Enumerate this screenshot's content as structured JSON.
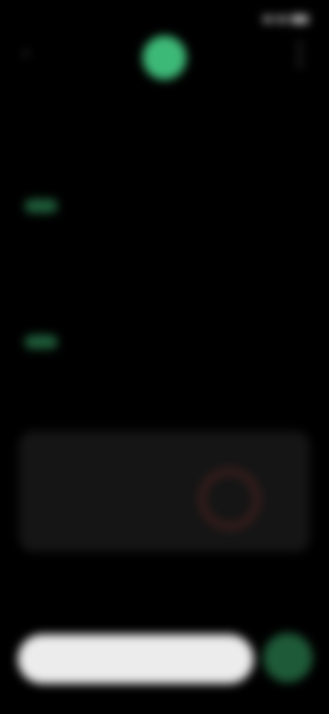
{
  "status_bar": {
    "time": "",
    "icons": [
      "signal-icon",
      "wifi-icon",
      "battery-icon"
    ]
  },
  "header": {
    "back_icon": "chevron-left-icon",
    "menu_icon": "more-vertical-icon",
    "avatar_color": "#3db977"
  },
  "tabs": [
    {
      "label": ""
    },
    {
      "label": ""
    },
    {
      "label": ""
    }
  ],
  "section1": {
    "title": "",
    "chips": [
      {
        "label": "",
        "active": true
      },
      {
        "label": "",
        "active": false
      },
      {
        "label": "",
        "active": false
      }
    ],
    "sub_items": [
      {
        "label": ""
      },
      {
        "label": ""
      }
    ]
  },
  "section2": {
    "title": "",
    "chips": [
      {
        "label": "",
        "active": true
      },
      {
        "label": "",
        "active": false
      },
      {
        "label": "",
        "active": false
      }
    ],
    "sub_items": [
      {
        "label": ""
      },
      {
        "label": ""
      }
    ]
  },
  "card": {
    "title": "",
    "caption": ""
  },
  "bottom": {
    "action_label": "",
    "fab_icon": "plus-icon"
  },
  "colors": {
    "accent": "#3db977",
    "accent_dark": "#1f5e3a",
    "background": "#000000",
    "card": "#151515"
  }
}
